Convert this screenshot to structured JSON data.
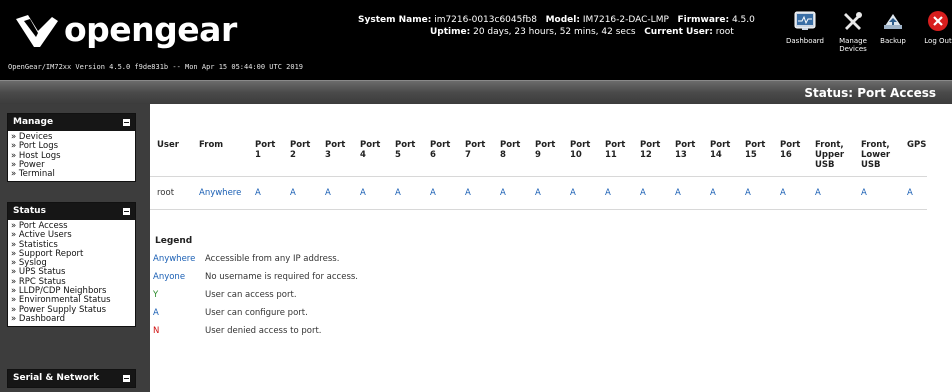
{
  "header": {
    "brand": "opengear",
    "version_line": "OpenGear/IM72xx Version 4.5.0 f9de831b -- Mon Apr 15 05:44:00 UTC 2019",
    "system_name_label": "System Name:",
    "system_name": "im7216-0013c6045fb8",
    "model_label": "Model:",
    "model": "IM7216-2-DAC-LMP",
    "firmware_label": "Firmware:",
    "firmware": "4.5.0",
    "uptime_label": "Uptime:",
    "uptime": "20 days, 23 hours, 52 mins, 42 secs",
    "current_user_label": "Current User:",
    "current_user": "root",
    "icons": [
      {
        "label": "Dashboard",
        "icon": "dashboard-icon"
      },
      {
        "label": "Manage Devices",
        "icon": "wrench-icon"
      },
      {
        "label": "Backup",
        "icon": "backup-icon"
      },
      {
        "label": "Log Out",
        "icon": "logout-icon"
      }
    ]
  },
  "page": {
    "title": "Status: Port Access"
  },
  "sidebar": {
    "manage": {
      "title": "Manage",
      "items": [
        "» Devices",
        "» Port Logs",
        "» Host Logs",
        "» Power",
        "» Terminal"
      ]
    },
    "status": {
      "title": "Status",
      "items": [
        "» Port Access",
        "» Active Users",
        "» Statistics",
        "» Support Report",
        "» Syslog",
        "» UPS Status",
        "» RPC Status",
        "» LLDP/CDP Neighbors",
        "» Environmental Status",
        "» Power Supply Status",
        "» Dashboard"
      ]
    },
    "serial": {
      "title": "Serial & Network"
    }
  },
  "table": {
    "headers": {
      "user": "User",
      "from": "From",
      "port_word": "Port",
      "ports": [
        "1",
        "2",
        "3",
        "4",
        "5",
        "6",
        "7",
        "8",
        "9",
        "10",
        "11",
        "12",
        "13",
        "14",
        "15",
        "16"
      ],
      "front_upper": [
        "Front,",
        "Upper",
        "USB"
      ],
      "front_lower": [
        "Front,",
        "Lower",
        "USB"
      ],
      "gps": "GPS"
    },
    "rows": [
      {
        "user": "root",
        "from": "Anywhere",
        "ports": [
          "A",
          "A",
          "A",
          "A",
          "A",
          "A",
          "A",
          "A",
          "A",
          "A",
          "A",
          "A",
          "A",
          "A",
          "A",
          "A"
        ],
        "front_upper": "A",
        "front_lower": "A",
        "gps": "A"
      }
    ]
  },
  "legend": {
    "title": "Legend",
    "items": [
      {
        "key": "Anywhere",
        "desc": "Accessible from any IP address.",
        "color": "#1a5fb4"
      },
      {
        "key": "Anyone",
        "desc": "No username is required for access.",
        "color": "#1a5fb4"
      },
      {
        "key": "Y",
        "desc": "User can access port.",
        "color": "#2a8a2a"
      },
      {
        "key": "A",
        "desc": "User can configure port.",
        "color": "#1a5fb4"
      },
      {
        "key": "N",
        "desc": "User denied access to port.",
        "color": "#d01010"
      }
    ]
  }
}
